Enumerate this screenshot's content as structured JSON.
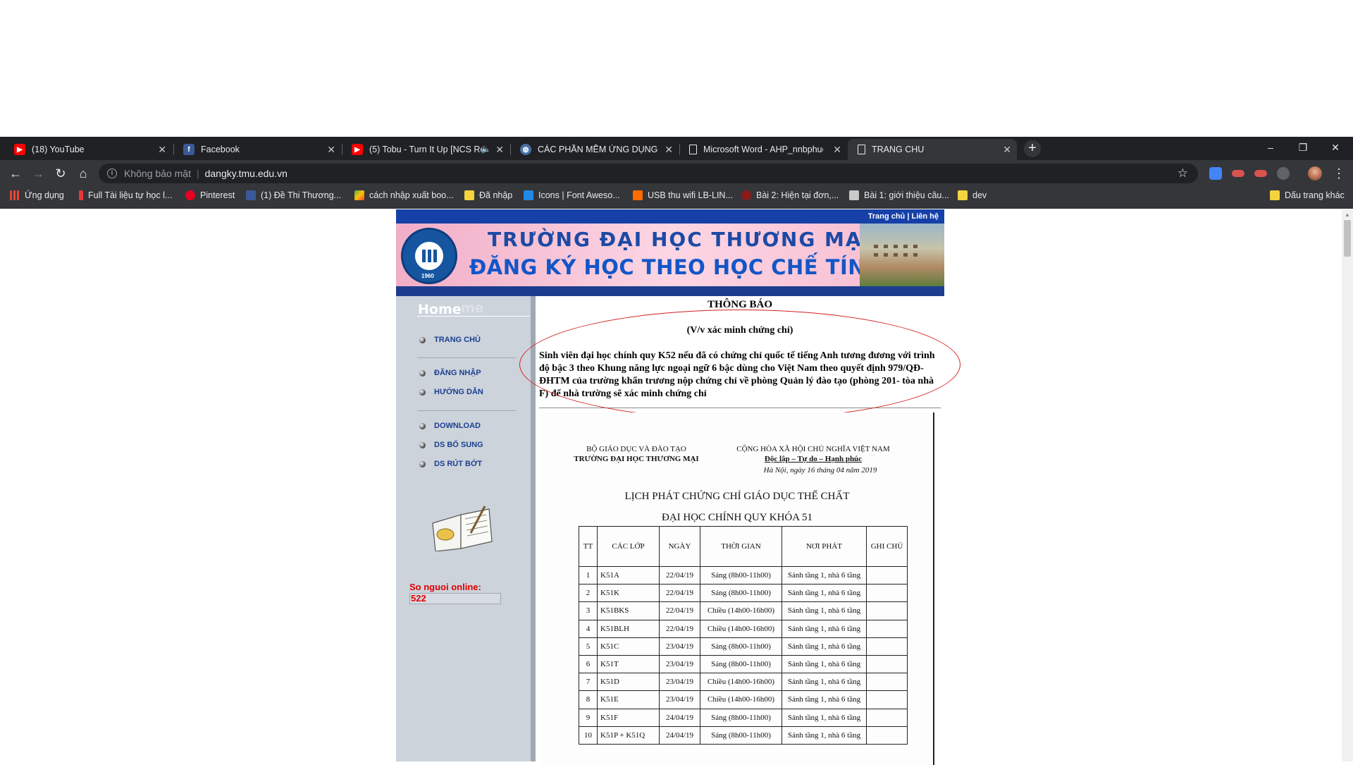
{
  "browser": {
    "tabs": [
      {
        "title": "(18) YouTube",
        "icon": "youtube-icon"
      },
      {
        "title": "Facebook",
        "icon": "facebook-icon"
      },
      {
        "title": "(5) Tobu - Turn It Up [NCS Re",
        "icon": "youtube-icon"
      },
      {
        "title": "CÁC PHẦN MỀM ỨNG DỤNG TRO",
        "icon": "globe-icon"
      },
      {
        "title": "Microsoft Word - AHP_nnbphuo",
        "icon": "document-icon"
      },
      {
        "title": "TRANG CHU",
        "icon": "document-icon",
        "active": true
      }
    ],
    "new_tab": "+",
    "window": {
      "minimize": "–",
      "maximize": "❐",
      "close": "✕"
    },
    "address": {
      "security_label": "Không bảo mật",
      "url": "dangky.tmu.edu.vn"
    },
    "bookmarks": [
      {
        "label": "Ứng dụng",
        "icon": "apps-icon"
      },
      {
        "label": "Full Tài liệu tự học l...",
        "icon": "bookmark-icon"
      },
      {
        "label": "Pinterest",
        "icon": "pinterest-icon"
      },
      {
        "label": "(1) Đề Thi Thương...",
        "icon": "facebook-icon"
      },
      {
        "label": "cách nhập xuất boo...",
        "icon": "bookmark-icon"
      },
      {
        "label": "Đã nhập",
        "icon": "folder-icon"
      },
      {
        "label": "Icons | Font Aweso...",
        "icon": "flag-icon"
      },
      {
        "label": "USB thu wifi LB-LIN...",
        "icon": "bookmark-icon"
      },
      {
        "label": "Bài 2: Hiện tại đơn,...",
        "icon": "bookmark-icon"
      },
      {
        "label": "Bài 1: giới thiệu câu...",
        "icon": "bookmark-icon"
      },
      {
        "label": "dev",
        "icon": "folder-icon"
      }
    ],
    "other_bookmarks": "Dấu trang khác"
  },
  "site": {
    "topnav": {
      "home": "Trang chủ",
      "separator": " | ",
      "contact": "Liên hệ"
    },
    "banner": {
      "title": "TRƯỜNG ĐẠI HỌC THƯƠNG MẠI",
      "subtitle": "ĐĂNG KÝ HỌC THEO HỌC CHẾ TÍN CHỈ",
      "logo_year": "1960"
    },
    "sidebar": {
      "home_heading": "Home",
      "home_ghost": "me",
      "menu": [
        "TRANG CHỦ",
        "ĐĂNG NHẬP",
        "HƯỚNG DẪN",
        "DOWNLOAD",
        "DS BỔ SUNG",
        "DS RÚT BỚT"
      ],
      "online_label": "So nguoi online:",
      "online_count": "522"
    },
    "notice": {
      "title": "THÔNG BÁO",
      "subtitle": "(V/v xác minh chứng chỉ)",
      "body": "Sinh viên đại học chính quy K52 nếu đã có chứng chỉ quốc tế tiếng Anh tương đương với trình độ bậc 3 theo Khung năng lực ngoại ngữ 6 bậc dùng cho Việt Nam theo quyết định 979/QĐ-ĐHTM của trường khẩn trương nộp chứng chỉ về phòng Quản lý đào tạo (phòng 201- tòa nhà F) để nhà trường sẽ xác minh chứng chỉ"
    },
    "document": {
      "left_header_1": "BỘ GIÁO DỤC VÀ ĐÀO TẠO",
      "left_header_2": "TRƯỜNG ĐẠI HỌC THƯƠNG MẠI",
      "right_header_1": "CỘNG HÒA XÃ HỘI CHỦ NGHĨA VIỆT NAM",
      "right_header_2": "Độc lập – Tự do – Hạnh phúc",
      "date": "Hà Nội, ngày 16  tháng 04 năm 2019",
      "title_1": "LỊCH PHÁT CHỨNG CHỈ GIÁO DỤC THỂ CHẤT",
      "title_2": "ĐẠI HỌC CHÍNH QUY KHÓA 51",
      "columns": [
        "TT",
        "CÁC LỚP",
        "NGÀY",
        "THỜI GIAN",
        "NƠI PHÁT",
        "GHI CHÚ"
      ],
      "rows": [
        [
          "1",
          "K51A",
          "22/04/19",
          "Sáng (8h00-11h00)",
          "Sảnh tầng 1, nhà 6 tầng",
          ""
        ],
        [
          "2",
          "K51K",
          "22/04/19",
          "Sáng (8h00-11h00)",
          "Sảnh tầng 1, nhà 6 tầng",
          ""
        ],
        [
          "3",
          "K51BKS",
          "22/04/19",
          "Chiều (14h00-16h00)",
          "Sảnh tầng 1, nhà 6 tầng",
          ""
        ],
        [
          "4",
          "K51BLH",
          "22/04/19",
          "Chiều (14h00-16h00)",
          "Sảnh tầng 1, nhà 6 tầng",
          ""
        ],
        [
          "5",
          "K51C",
          "23/04/19",
          "Sáng (8h00-11h00)",
          "Sảnh tầng 1, nhà 6 tầng",
          ""
        ],
        [
          "6",
          "K51T",
          "23/04/19",
          "Sáng (8h00-11h00)",
          "Sảnh tầng 1, nhà 6 tầng",
          ""
        ],
        [
          "7",
          "K51D",
          "23/04/19",
          "Chiều (14h00-16h00)",
          "Sảnh tầng 1, nhà 6 tầng",
          ""
        ],
        [
          "8",
          "K51E",
          "23/04/19",
          "Chiều (14h00-16h00)",
          "Sảnh tầng 1, nhà 6 tầng",
          ""
        ],
        [
          "9",
          "K51F",
          "24/04/19",
          "Sáng (8h00-11h00)",
          "Sảnh tầng 1, nhà 6 tầng",
          ""
        ],
        [
          "10",
          "K51P + K51Q",
          "24/04/19",
          "Sáng (8h00-11h00)",
          "Sảnh tầng 1, nhà 6 tầng",
          ""
        ]
      ]
    }
  }
}
